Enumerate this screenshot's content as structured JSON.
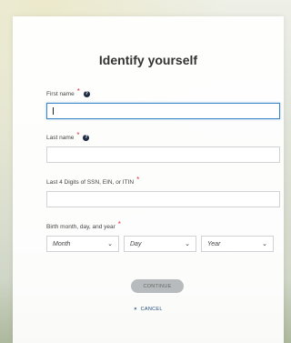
{
  "form": {
    "title": "Identify yourself",
    "first_name_label": "First name",
    "first_name_value": "",
    "last_name_label": "Last name",
    "last_name_value": "",
    "ssn_label": "Last 4 Digits of SSN, EIN, or ITIN",
    "ssn_value": "",
    "birth_label": "Birth month, day, and year",
    "month_selected": "Month",
    "day_selected": "Day",
    "year_selected": "Year",
    "required_marker": "*",
    "help_symbol": "?",
    "continue_label": "CONTINUE",
    "cancel_label": "CANCEL",
    "cancel_icon_char": "×"
  },
  "icons": [
    "help-icon",
    "chevron-down-icon",
    "close-icon"
  ],
  "colors": {
    "required": "#e0344b",
    "focus_border": "#3a86c8",
    "link": "#1f4a7a",
    "button_disabled": "#b8bbbd"
  }
}
